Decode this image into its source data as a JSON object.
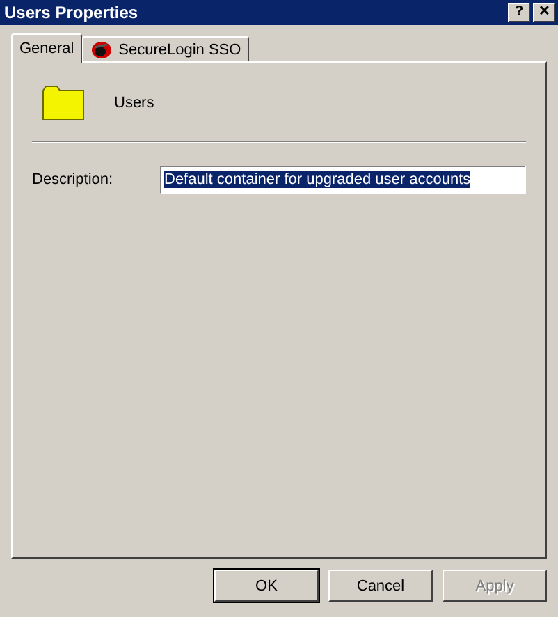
{
  "window": {
    "title": "Users Properties",
    "title_buttons": [
      {
        "kind": "help",
        "label": "?"
      },
      {
        "kind": "close",
        "label": "✕"
      }
    ]
  },
  "tabs": [
    {
      "label": "General",
      "selected": true,
      "icon": false
    },
    {
      "label": "SecureLogin SSO",
      "selected": false,
      "icon": true
    }
  ],
  "object": {
    "name": "Users"
  },
  "description": {
    "label": "Description:",
    "value": "Default container for upgraded user accounts",
    "text_selected": true
  },
  "buttons": [
    {
      "label": "OK",
      "default": true,
      "disabled": false
    },
    {
      "label": "Cancel",
      "default": false,
      "disabled": false
    },
    {
      "label": "Apply",
      "default": false,
      "disabled": true
    }
  ]
}
